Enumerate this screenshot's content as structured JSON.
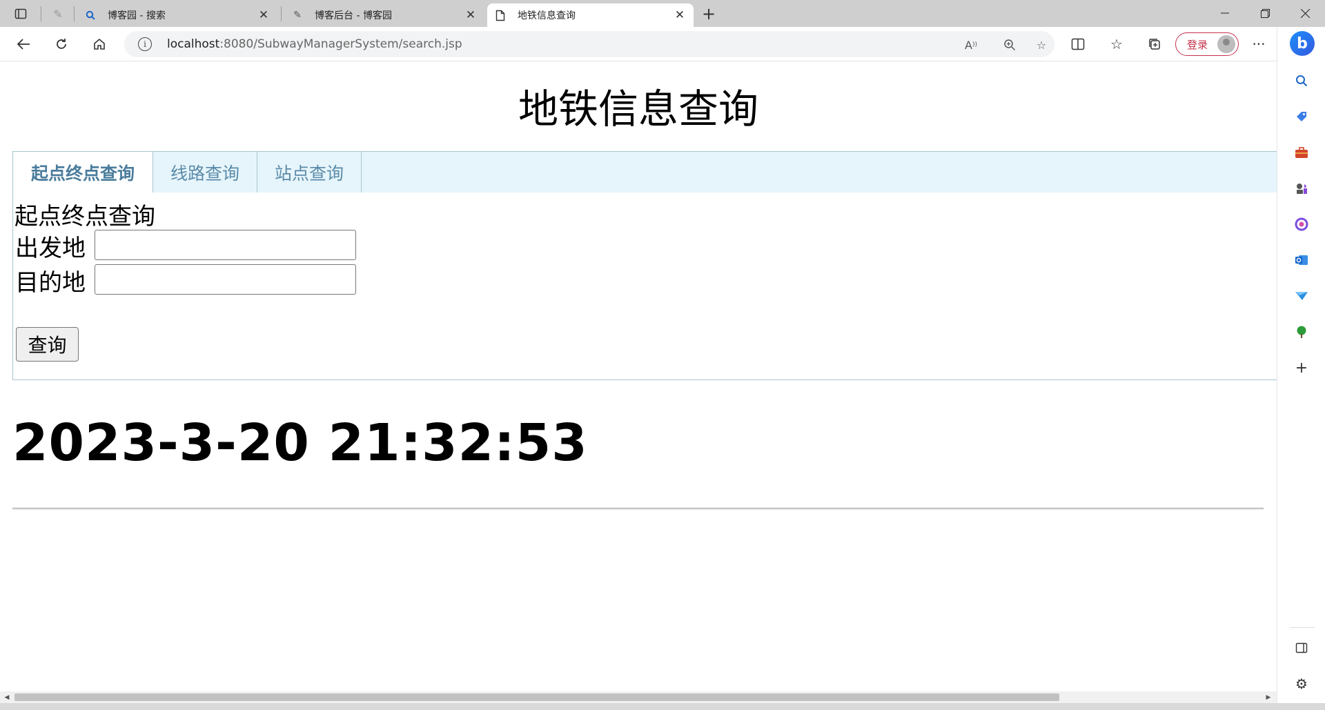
{
  "browser": {
    "tabs": [
      {
        "title": "博客园 - 搜索",
        "favicon": "search-icon"
      },
      {
        "title": "博客后台 - 博客园",
        "favicon": "cnblogs-icon"
      },
      {
        "title": "地铁信息查询",
        "favicon": "page-icon",
        "active": true
      }
    ],
    "address": {
      "host": "localhost",
      "rest": ":8080/SubwayManagerSystem/search.jsp"
    },
    "login_label": "登录"
  },
  "page": {
    "title": "地铁信息查询",
    "tabs": [
      {
        "label": "起点终点查询",
        "active": true
      },
      {
        "label": "线路查询",
        "active": false
      },
      {
        "label": "站点查询",
        "active": false
      }
    ],
    "section_title": "起点终点查询",
    "from_label": "出发地",
    "to_label": "目的地",
    "from_value": "",
    "to_value": "",
    "query_button": "查询",
    "datetime": "2023-3-20 21:32:53"
  },
  "colors": {
    "tab_bar_bg": "#e6f5fb",
    "tab_text": "#5a8aa8",
    "panel_border": "#a9c4d0",
    "login_accent": "#c4314b"
  }
}
